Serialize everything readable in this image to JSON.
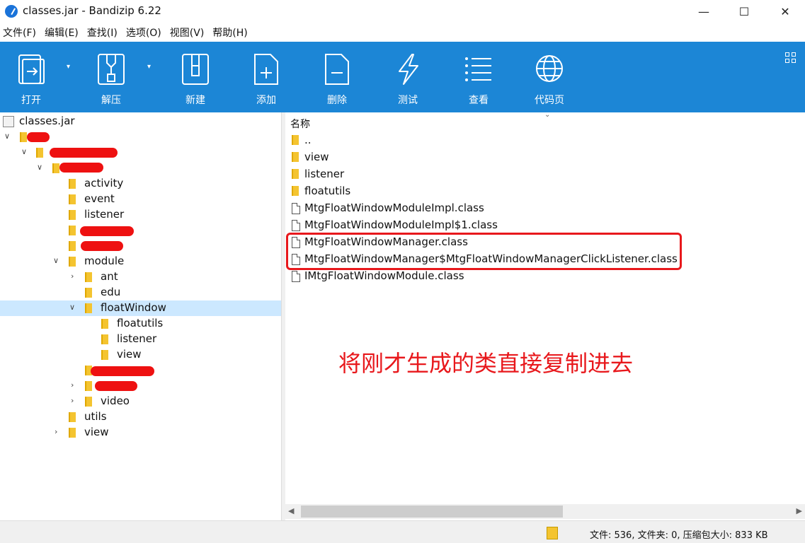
{
  "window": {
    "title": "classes.jar - Bandizip 6.22",
    "min_glyph": "—",
    "max_glyph": "☐",
    "close_glyph": "✕"
  },
  "menu": [
    "文件(F)",
    "编辑(E)",
    "查找(I)",
    "选项(O)",
    "视图(V)",
    "帮助(H)"
  ],
  "toolbar": {
    "accent": "#1c86d6",
    "items": [
      {
        "label": "打开",
        "icon": "open-icon"
      },
      {
        "label": "解压",
        "icon": "extract-icon"
      },
      {
        "label": "新建",
        "icon": "new-archive-icon"
      },
      {
        "label": "添加",
        "icon": "add-file-icon"
      },
      {
        "label": "删除",
        "icon": "delete-file-icon"
      },
      {
        "label": "测试",
        "icon": "test-icon"
      },
      {
        "label": "查看",
        "icon": "view-list-icon"
      },
      {
        "label": "代码页",
        "icon": "codepage-globe-icon"
      }
    ]
  },
  "tree": {
    "root": "classes.jar",
    "items": [
      {
        "label": "",
        "expanded": true,
        "redacted": true
      },
      {
        "label": "",
        "expanded": true,
        "redacted": true
      },
      {
        "label": "",
        "expanded": true,
        "redacted": true
      },
      {
        "label": "activity"
      },
      {
        "label": "event"
      },
      {
        "label": "listener"
      },
      {
        "label": "",
        "redacted": true
      },
      {
        "label": "",
        "redacted": true
      },
      {
        "label": "module",
        "expanded": true
      },
      {
        "label": "ant",
        "collapsed": true
      },
      {
        "label": "edu"
      },
      {
        "label": "floatWindow",
        "expanded": true,
        "selected": true
      },
      {
        "label": "floatutils"
      },
      {
        "label": "listener"
      },
      {
        "label": "view"
      },
      {
        "label": "",
        "redacted": true
      },
      {
        "label": "",
        "collapsed": true,
        "redacted": true
      },
      {
        "label": "video",
        "collapsed": true
      },
      {
        "label": "utils"
      },
      {
        "label": "view",
        "collapsed": true
      }
    ]
  },
  "list": {
    "column_name": "名称",
    "files": [
      {
        "name": "..",
        "type": "folder"
      },
      {
        "name": "view",
        "type": "folder"
      },
      {
        "name": "listener",
        "type": "folder"
      },
      {
        "name": "floatutils",
        "type": "folder"
      },
      {
        "name": "MtgFloatWindowModuleImpl.class",
        "type": "file"
      },
      {
        "name": "MtgFloatWindowModuleImpl$1.class",
        "type": "file"
      },
      {
        "name": "MtgFloatWindowManager.class",
        "type": "file"
      },
      {
        "name": "MtgFloatWindowManager$MtgFloatWindowManagerClickListener.class",
        "type": "file"
      },
      {
        "name": "IMtgFloatWindowModule.class",
        "type": "file"
      }
    ]
  },
  "annotation": {
    "text": "将刚才生成的类直接复制进去",
    "color": "#e8181c"
  },
  "status": {
    "text": "文件: 536, 文件夹: 0, 压缩包大小: 833 KB"
  }
}
